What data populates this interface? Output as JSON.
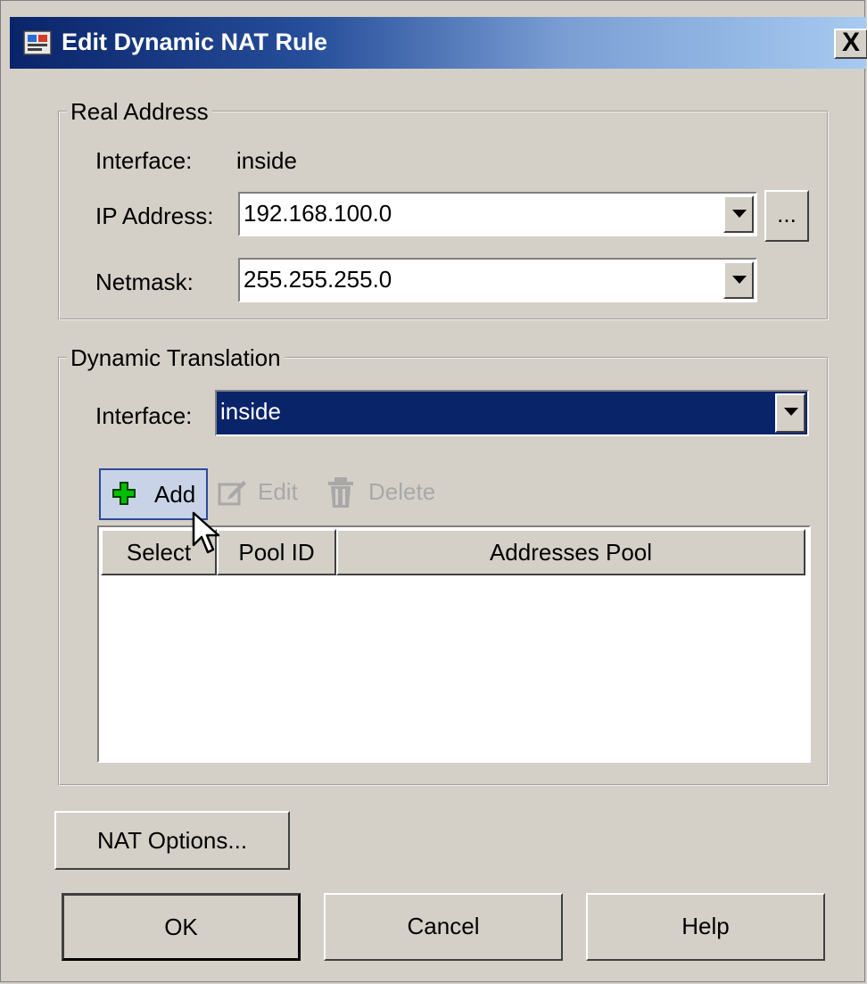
{
  "dialog": {
    "title": "Edit Dynamic NAT Rule",
    "close_label": "X"
  },
  "real_address": {
    "legend": "Real Address",
    "interface_label": "Interface:",
    "interface_value": "inside",
    "ip_label": "IP Address:",
    "ip_value": "192.168.100.0",
    "browse_label": "...",
    "netmask_label": "Netmask:",
    "netmask_value": "255.255.255.0"
  },
  "dynamic_translation": {
    "legend": "Dynamic Translation",
    "interface_label": "Interface:",
    "interface_value": "inside",
    "toolbar": {
      "add_label": "Add",
      "edit_label": "Edit",
      "delete_label": "Delete"
    },
    "table": {
      "columns": [
        "Select",
        "Pool ID",
        "Addresses Pool"
      ],
      "rows": []
    }
  },
  "buttons": {
    "nat_options": "NAT Options...",
    "ok": "OK",
    "cancel": "Cancel",
    "help": "Help"
  },
  "colors": {
    "selection": "#0a246a",
    "add_icon": "#00c000",
    "dialog_bg": "#d4d0c8"
  }
}
